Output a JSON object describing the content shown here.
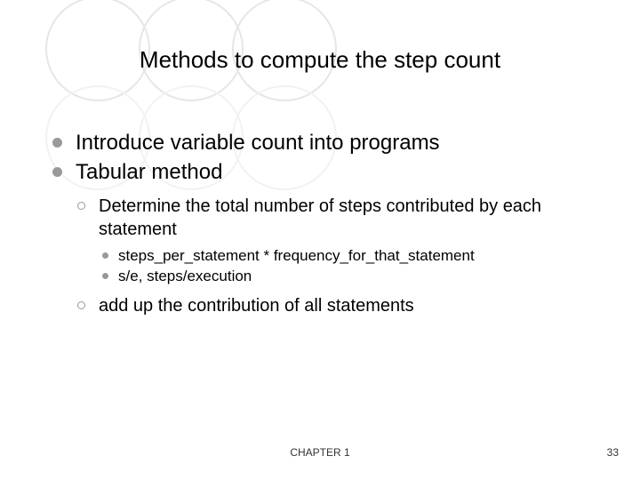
{
  "title": "Methods to compute the step count",
  "bullets_lvl1": {
    "a": "Introduce variable count into programs",
    "b": "Tabular method"
  },
  "tabular": {
    "sub1": "Determine the total number of steps contributed by each statement",
    "sub1_details": {
      "a": "steps_per_statement * frequency_for_that_statement",
      "b": "s/e, steps/execution"
    },
    "sub2": "add up the contribution of all statements"
  },
  "footer": {
    "chapter": "CHAPTER 1",
    "page": "33"
  }
}
